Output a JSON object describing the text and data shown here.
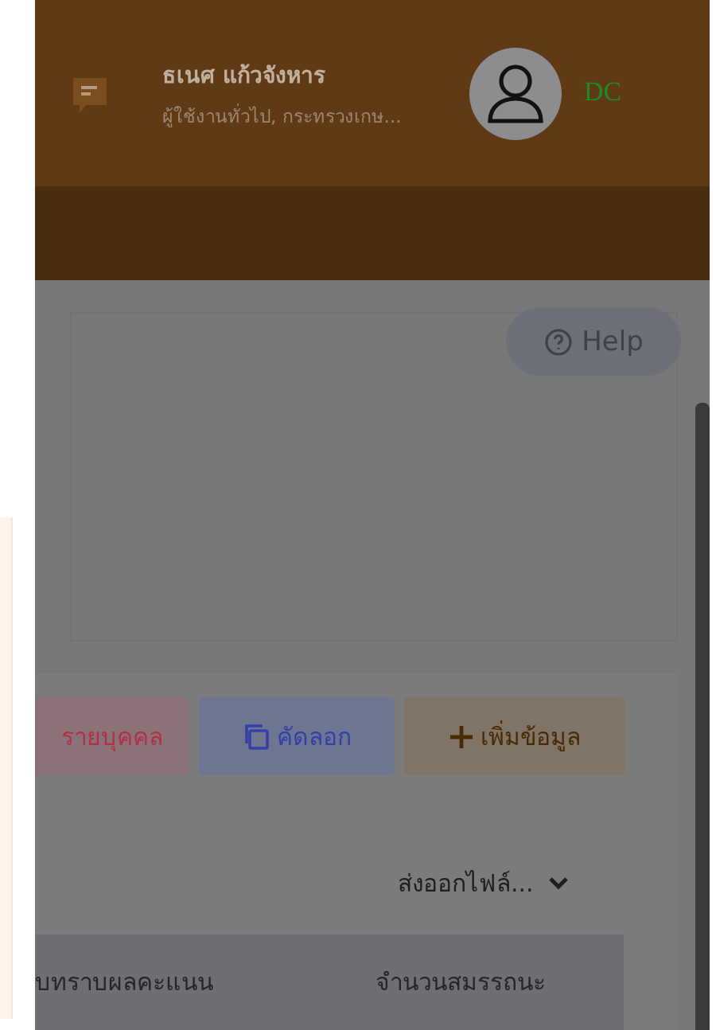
{
  "header": {
    "user_name": "ธเนศ แก้วจังหาร",
    "user_role": "ผู้ใช้งานทั่วไป, กระทรวงเกษ...",
    "badge": "DC"
  },
  "help_button": {
    "label": "Help"
  },
  "actions": [
    {
      "kind": "danger",
      "label": "รายบุคคล"
    },
    {
      "kind": "copy",
      "label": "คัดลอก"
    },
    {
      "kind": "add",
      "label": "เพิ่มข้อมูล"
    }
  ],
  "export_menu": {
    "label": "ส่งออกไฟล์..."
  },
  "table": {
    "columns": [
      "บทราบผลคะแนน",
      "จำนวนสมรรถนะ"
    ]
  }
}
